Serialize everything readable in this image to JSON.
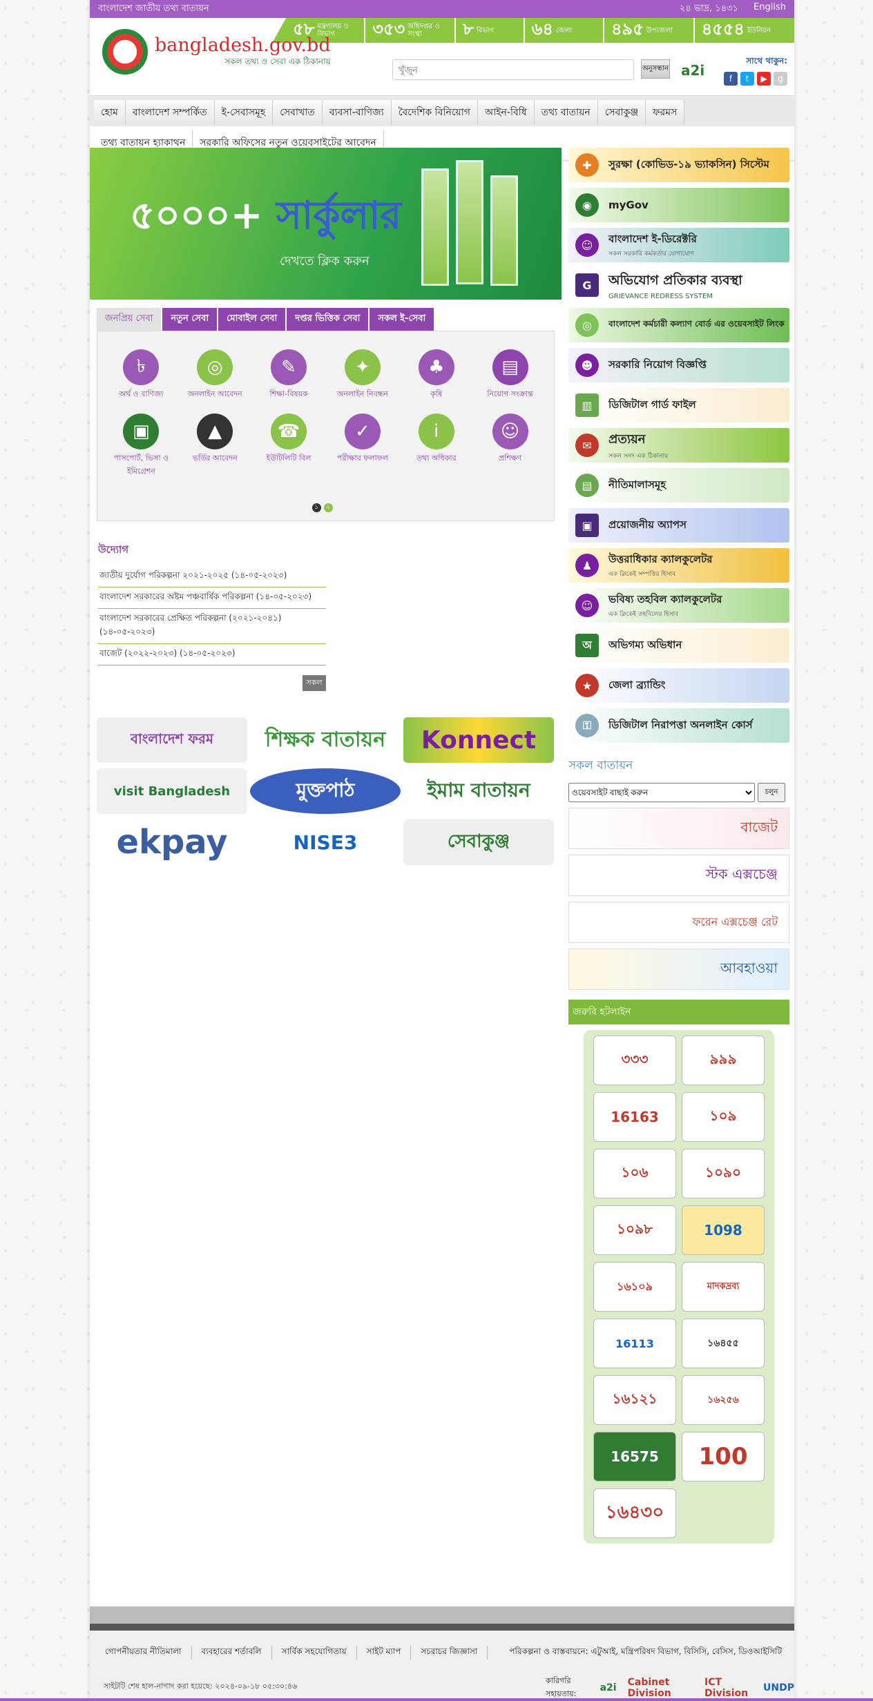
{
  "topbar": {
    "title": "বাংলাদেশ জাতীয় তথ্য বাতায়ন",
    "date": "২৪ ভাদ্র, ১৪৩১",
    "lang": "English"
  },
  "stats": [
    {
      "n": "৫৮",
      "l": "মন্ত্রণালয় ও বিভাগ"
    },
    {
      "n": "৩৫৩",
      "l": "অধিদপ্তর ও সংস্থা"
    },
    {
      "n": "৮",
      "l": "বিভাগ"
    },
    {
      "n": "৬৪",
      "l": "জেলা"
    },
    {
      "n": "৪৯৫",
      "l": "উপজেলা"
    },
    {
      "n": "৪৫৫৪",
      "l": "ইউনিয়ন"
    }
  ],
  "logo": {
    "title": "bangladesh.gov.bd",
    "tagline": "সকল তথ্য ও সেবা এক ঠিকানায়"
  },
  "search": {
    "placeholder": "খুঁজুন",
    "button": "অনুসন্ধান"
  },
  "a2i": "a2i",
  "follow": "সাথে থাকুন:",
  "menu": [
    "হোম",
    "বাংলাদেশ সম্পর্কিত",
    "ই-সেবাসমূহ",
    "সেবাখাত",
    "ব্যবসা-বাণিজ্য",
    "বৈদেশিক বিনিয়োগ",
    "আইন-বিধি",
    "তথ্য বাতায়ন",
    "সেবাকুঞ্জ",
    "ফরমস"
  ],
  "menu2": [
    "তথ্য বাতায়ন হ্যাকাথন",
    "সরকারি অফিসের নতুন ওয়েবসাইটের আবেদন"
  ],
  "banner": {
    "num": "৫০০০+",
    "word": "সার্কুলার",
    "cta": "দেখতে ক্লিক করুন"
  },
  "tabs": [
    "জনপ্রিয় সেবা",
    "নতুন সেবা",
    "মোবাইল সেবা",
    "দপ্তর ভিত্তিক সেবা",
    "সকল ই-সেবা"
  ],
  "services": [
    "অর্থ ও বাণিজ্য",
    "অনলাইন আবেদন",
    "শিক্ষা-বিষয়ক",
    "অনলাইন নিবন্ধন",
    "কৃষি",
    "নিয়োগ সংক্রান্ত",
    "পাসপোর্ট, ভিসা ও ইমিগ্রেশন",
    "ভর্তির আবেদন",
    "ইউটিলিটি বিল",
    "পরীক্ষার ফলাফল",
    "তথ্য অধিকার",
    "প্রশিক্ষণ"
  ],
  "pager": [
    "১",
    "২"
  ],
  "initiatives": {
    "title": "উদ্যোগ",
    "items": [
      "জাতীয় দুর্যোগ পরিকল্পনা ২০২১-২০২৫ (১৪-০৫-২০২৩)",
      "বাংলাদেশ সরকারের অষ্টম পঞ্চবার্ষিক পরিকল্পনা (১৪-০৫-২০২৩)",
      "বাংলাদেশ সরকারের প্রেক্ষিত পরিকল্পনা (২০২১-২০৪১) (১৪-০৫-২০২৩)",
      "বাজেট (২০২২-২০২৩) (১৪-০৫-২০২৩)"
    ],
    "all": "সকল"
  },
  "logos": [
    "বাংলাদেশ ফরম",
    "শিক্ষক বাতায়ন",
    "Konnect",
    "visit Bangladesh",
    "মুক্তপাঠ",
    "ইমাম বাতায়ন",
    "ekpay",
    "NISE3",
    "সেবাকুঞ্জ"
  ],
  "rightbanners": [
    {
      "t": "সুরক্ষা (কোভিড-১৯ ভ্যাকসিন) সিস্টেম",
      "s": ""
    },
    {
      "t": "myGov",
      "s": ""
    },
    {
      "t": "বাংলাদেশ ই-ডিরেক্টরি",
      "s": "সকল সরকারি কর্মকর্তার যোগাযোগ"
    },
    {
      "t": "অভিযোগ প্রতিকার ব্যবস্থা",
      "s": "GRIEVANCE REDRESS SYSTEM"
    },
    {
      "t": "বাংলাদেশ কর্মচারী কল্যাণ বোর্ড এর ওয়েবসাইট লিংক",
      "s": ""
    },
    {
      "t": "সরকারি নিয়োগ বিজ্ঞপ্তি",
      "s": ""
    },
    {
      "t": "ডিজিটাল গার্ড ফাইল",
      "s": ""
    },
    {
      "t": "প্রত্যয়ন",
      "s": "সকল সনদ এক ঠিকানায়"
    },
    {
      "t": "নীতিমালাসমূহ",
      "s": ""
    },
    {
      "t": "প্রয়োজনীয় অ্যাপস",
      "s": ""
    },
    {
      "t": "উত্তরাধিকার ক্যালকুলেটর",
      "s": "এক ক্লিকেই সম্পত্তির হিসাব"
    },
    {
      "t": "ভবিষ্য তহবিল ক্যালকুলেটর",
      "s": "এক ক্লিকেই তহবিলের হিসাব"
    },
    {
      "t": "অভিগম্য অভিধান",
      "s": ""
    },
    {
      "t": "জেলা ব্র্যান্ডিং",
      "s": ""
    },
    {
      "t": "ডিজিটাল নিরাপত্তা অনলাইন কোর্স",
      "s": ""
    }
  ],
  "portals": {
    "title": "সকল বাতায়ন",
    "select": "ওয়েবসাইট বাছাই করুন",
    "go": "চলুন"
  },
  "sidebanners": [
    "বাজেট",
    "স্টক এক্সচেঞ্জ",
    "ফরেন এক্সচেঞ্জ রেট",
    "আবহাওয়া"
  ],
  "hotline": {
    "title": "জরুরি হটলাইন",
    "items": [
      "৩৩৩",
      "৯৯৯",
      "16163",
      "১০৯",
      "১০৬",
      "১০৯০",
      "১০৯৮",
      "1098",
      "১৬১০৯",
      "মাদকদ্রব্য",
      "16113",
      "১৬৪৫৫",
      "১৬১২১",
      "১৬২৫৬",
      "16575",
      "100",
      "১৬৪৩০"
    ]
  },
  "footer": {
    "links": [
      "গোপনীয়তার নীতিমালা",
      "ব্যবহারের শর্তাবলি",
      "সার্বিক সহযোগিতায়",
      "সাইট ম্যাপ",
      "সচরাচর জিজ্ঞাসা"
    ],
    "plan": "পরিকল্পনা ও বাস্তবায়নে: এটুআই, মন্ত্রিপরিষদ বিভাগ, বিসিসি, বেসিস, ডিওআইসিটি",
    "updated": "সাইটটি শেষ হাল-নাগাদ করা হয়েছে: ২০২৪-০৯-১৮ ০৫:৩০:৪৬",
    "tech": "কারিগরি সহায়তায়:",
    "partners": [
      "a2i",
      "Cabinet Division",
      "ICT Division",
      "UNDP"
    ]
  },
  "colors": {
    "purple": "#a15dc3",
    "green": "#8dc63f"
  }
}
